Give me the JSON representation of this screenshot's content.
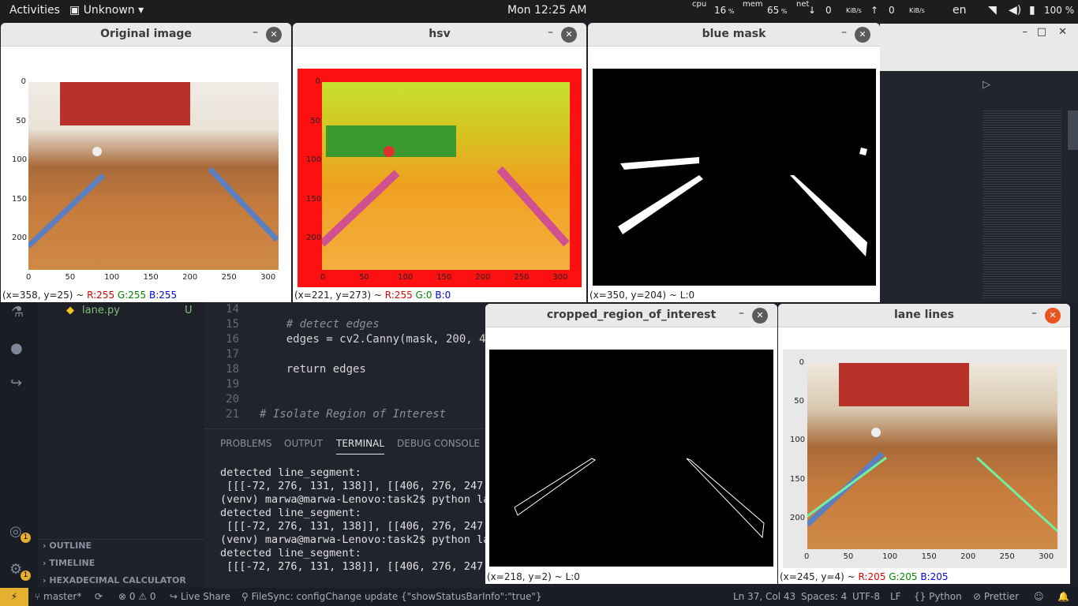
{
  "topbar": {
    "activities": "Activities",
    "app": "Unknown",
    "clock": "Mon 12:25 AM",
    "cpu_label": "cpu",
    "cpu_val": "16",
    "mem_label": "mem",
    "mem_val": "65",
    "net_label": "net",
    "down": "0",
    "up": "0",
    "unit": "KiB/s",
    "lang": "en",
    "battery": "100 %"
  },
  "windows": {
    "original": {
      "title": "Original image",
      "status_pre": "(x=358, y=25) ~ ",
      "r": "R:255",
      "g": "G:255",
      "b": "B:255"
    },
    "hsv": {
      "title": "hsv",
      "status_pre": "(x=221, y=273) ~ ",
      "r": "R:255",
      "g": "G:0",
      "b": "B:0"
    },
    "mask": {
      "title": "blue mask",
      "status": "(x=350, y=204) ~ L:0"
    },
    "roi": {
      "title": "cropped_region_of_interest",
      "status": "(x=218, y=2) ~ L:0"
    },
    "lanes": {
      "title": "lane lines",
      "status_pre": "(x=245, y=4) ~ ",
      "r": "R:205",
      "g": "G:205",
      "b": "B:205"
    }
  },
  "axes": {
    "x_ticks_320": [
      "0",
      "50",
      "100",
      "150",
      "200",
      "250",
      "300"
    ],
    "y_ticks_240": [
      "0",
      "50",
      "100",
      "150",
      "200"
    ]
  },
  "sidebar": {
    "file": "lane.py",
    "file_badge": "U",
    "outline": "OUTLINE",
    "timeline": "TIMELINE",
    "hexcalc": "HEXADECIMAL CALCULATOR",
    "badge1": "1",
    "badge2": "1"
  },
  "code": {
    "lines": [
      {
        "n": "14",
        "t": ""
      },
      {
        "n": "15",
        "t": "    # detect edges"
      },
      {
        "n": "16",
        "t": "    edges = cv2.Canny(mask, 200, 4"
      },
      {
        "n": "17",
        "t": ""
      },
      {
        "n": "18",
        "t": "    return edges"
      },
      {
        "n": "19",
        "t": ""
      },
      {
        "n": "20",
        "t": ""
      },
      {
        "n": "21",
        "t": "# Isolate Region of Interest"
      }
    ]
  },
  "panel": {
    "tabs": [
      "PROBLEMS",
      "OUTPUT",
      "TERMINAL",
      "DEBUG CONSOLE"
    ],
    "terminal": [
      "detected line_segment:",
      " [[[-72, 276, 131, 138]], [[406, 276, 247,",
      "(venv) marwa@marwa-Lenovo:task2$ python la",
      "detected line_segment:",
      " [[[-72, 276, 131, 138]], [[406, 276, 247,",
      "(venv) marwa@marwa-Lenovo:task2$ python la",
      "detected line_segment:",
      " [[[-72, 276, 131, 138]], [[406, 276, 247,"
    ]
  },
  "statusbar": {
    "branch": "master*",
    "errors": "0",
    "warnings": "0",
    "liveshare": "Live Share",
    "filesync": "FileSync: configChange update {\"showStatusBarInfo\":\"true\"}",
    "pos": "Ln 37, Col 43",
    "spaces": "Spaces: 4",
    "enc": "UTF-8",
    "eol": "LF",
    "lang": "Python",
    "prettier": "Prettier"
  }
}
